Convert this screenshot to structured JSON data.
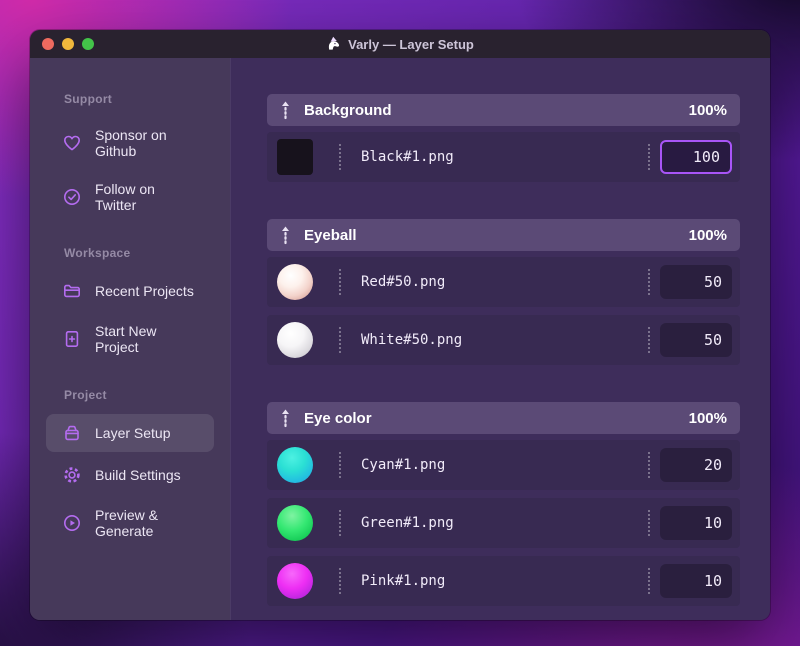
{
  "window": {
    "title": "Varly — Layer Setup",
    "app_icon": "unicorn-icon",
    "traffic_lights": [
      "close",
      "minimize",
      "zoom"
    ]
  },
  "sidebar": {
    "sections": [
      {
        "label": "Support",
        "items": [
          {
            "label": "Sponsor on Github",
            "icon": "heart-icon"
          },
          {
            "label": "Follow on Twitter",
            "icon": "badge-check-icon"
          }
        ]
      },
      {
        "label": "Workspace",
        "items": [
          {
            "label": "Recent Projects",
            "icon": "folder-icon"
          },
          {
            "label": "Start New Project",
            "icon": "file-plus-icon"
          }
        ]
      },
      {
        "label": "Project",
        "items": [
          {
            "label": "Layer Setup",
            "icon": "archive-box-icon",
            "selected": true
          },
          {
            "label": "Build Settings",
            "icon": "gear-icon"
          },
          {
            "label": "Preview & Generate",
            "icon": "play-circle-icon"
          }
        ]
      }
    ]
  },
  "layers": {
    "groups": [
      {
        "name": "Background",
        "weight": "100%",
        "items": [
          {
            "file": "Black#1.png",
            "value": "100",
            "thumb": "black-square",
            "focused": true
          }
        ]
      },
      {
        "name": "Eyeball",
        "weight": "100%",
        "items": [
          {
            "file": "Red#50.png",
            "value": "50",
            "thumb": "red-sphere"
          },
          {
            "file": "White#50.png",
            "value": "50",
            "thumb": "white-sphere"
          }
        ]
      },
      {
        "name": "Eye color",
        "weight": "100%",
        "items": [
          {
            "file": "Cyan#1.png",
            "value": "20",
            "thumb": "cyan-sphere"
          },
          {
            "file": "Green#1.png",
            "value": "10",
            "thumb": "green-sphere"
          },
          {
            "file": "Pink#1.png",
            "value": "10",
            "thumb": "pink-sphere"
          }
        ]
      }
    ]
  },
  "colors": {
    "accent": "#a855f7",
    "sidebar_icon": "#b46cf0",
    "traffic_close": "#ed6a5f",
    "traffic_minimize": "#f0b73c",
    "traffic_zoom": "#43c349"
  }
}
